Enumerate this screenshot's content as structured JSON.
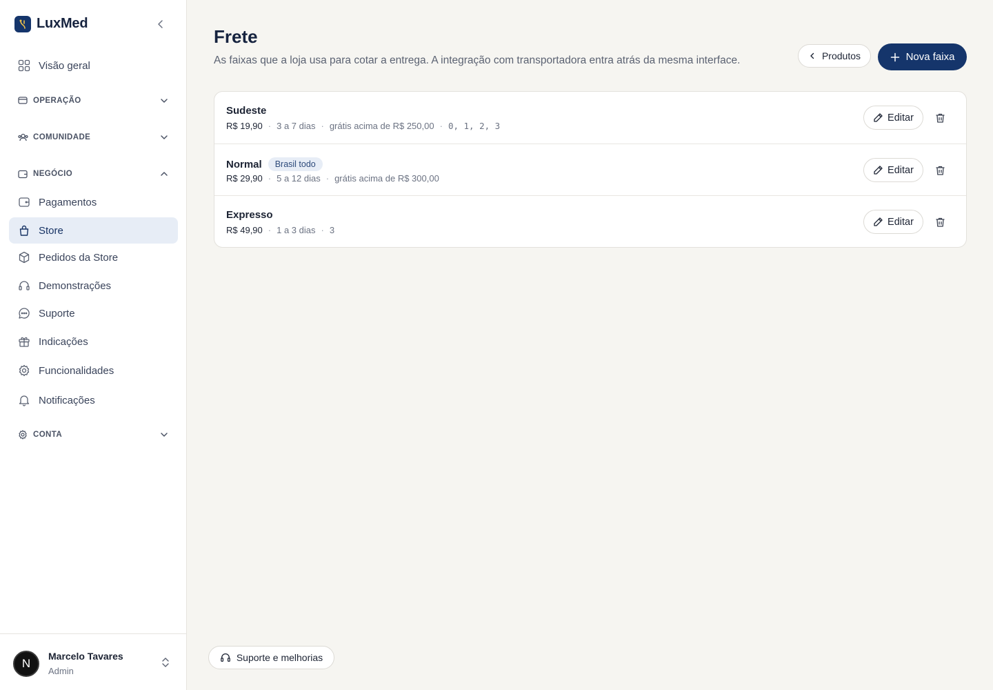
{
  "brand": {
    "name": "LuxMed"
  },
  "sidebar": {
    "overview": {
      "label": "Visão geral",
      "icon": "grid-icon"
    },
    "groups": {
      "operacao": {
        "label": "OPERAÇÃO",
        "expanded": false
      },
      "comunidade": {
        "label": "COMUNIDADE",
        "expanded": false
      },
      "negocio": {
        "label": "NEGÓCIO",
        "expanded": true
      },
      "conta": {
        "label": "CONTA",
        "expanded": false
      }
    },
    "items": [
      {
        "label": "Pagamentos",
        "icon": "wallet-icon"
      },
      {
        "label": "Store",
        "icon": "shopping-bag-icon",
        "active": true
      },
      {
        "label": "Pedidos da Store",
        "icon": "package-icon"
      },
      {
        "label": "Demonstrações",
        "icon": "headset-icon"
      },
      {
        "label": "Suporte",
        "icon": "chat-icon"
      },
      {
        "label": "Indicações",
        "icon": "gift-icon"
      },
      {
        "label": "Funcionalidades",
        "icon": "gear-icon"
      },
      {
        "label": "Notificações",
        "icon": "bell-icon"
      }
    ]
  },
  "user": {
    "initial": "N",
    "name": "Marcelo Tavares",
    "role": "Admin"
  },
  "header": {
    "title": "Frete",
    "subtitle": "As faixas que a loja usa para cotar a entrega. A integração com transportadora entra atrás da mesma interface.",
    "back_label": "Produtos",
    "new_label": "Nova faixa"
  },
  "shipping": {
    "edit_label": "Editar",
    "rows": [
      {
        "name": "Sudeste",
        "badge": "",
        "price": "R$ 19,90",
        "days": "3 a 7 dias",
        "free": "grátis acima de R$ 250,00",
        "codes": "0, 1, 2, 3"
      },
      {
        "name": "Normal",
        "badge": "Brasil todo",
        "price": "R$ 29,90",
        "days": "5 a 12 dias",
        "free": "grátis acima de R$ 300,00",
        "codes": ""
      },
      {
        "name": "Expresso",
        "badge": "",
        "price": "R$ 49,90",
        "days": "1 a 3 dias",
        "free": "",
        "codes": "3"
      }
    ]
  },
  "footer": {
    "support_label": "Suporte e melhorias"
  },
  "colors": {
    "primary": "#15356b",
    "active_bg": "#e7edf6",
    "background": "#f6f5f1"
  }
}
